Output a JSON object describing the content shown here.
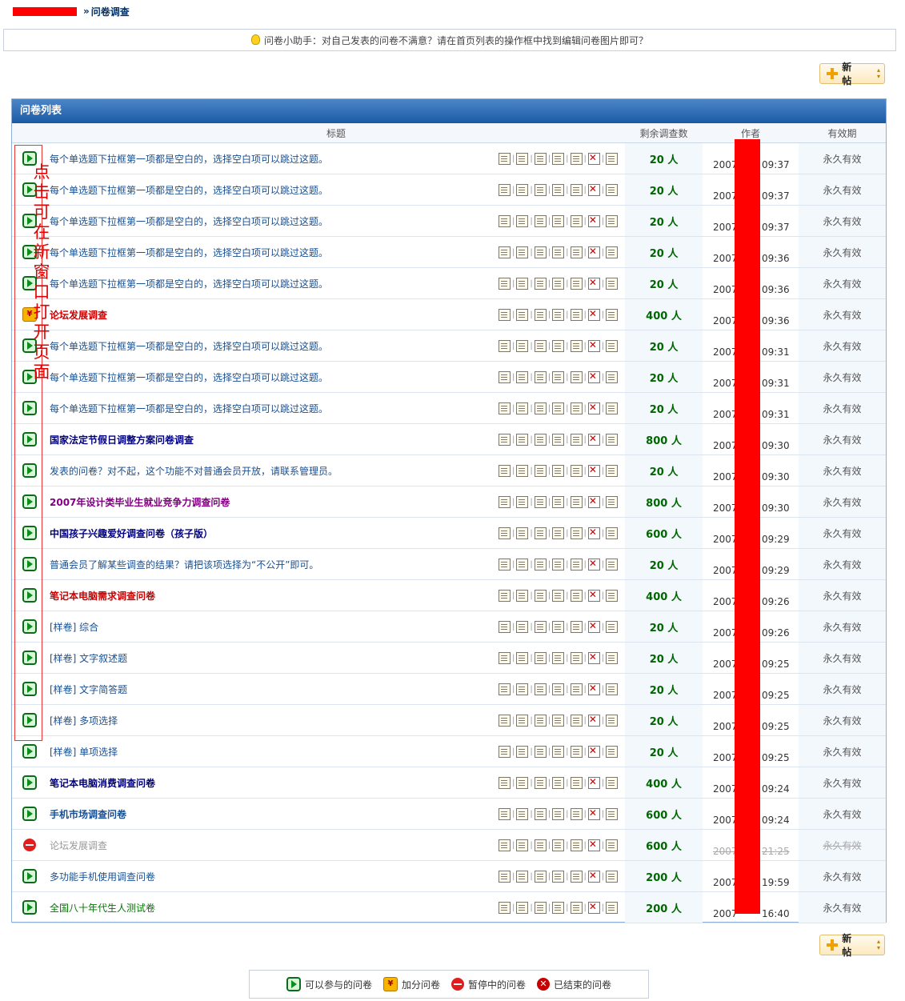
{
  "breadcrumb": {
    "sep": "»",
    "current": "问卷调查"
  },
  "tip": {
    "text": "问卷小助手：对自己发表的问卷不满意？请在首页列表的操作框中找到编辑问卷图片即可？"
  },
  "buttons": {
    "new_post": "新 帖"
  },
  "list": {
    "title": "问卷列表",
    "columns": {
      "title": "标题",
      "remaining": "剩余调查数",
      "author": "作者",
      "validity": "有效期"
    },
    "rows": [
      {
        "status": "play",
        "title": "每个单选题下拉框第一项都是空白的，选择空白项可以跳过这题。",
        "title_color": "#1a4f8f",
        "bold": false,
        "count": "20 人",
        "year": "2007",
        "time": "09:37",
        "validity": "永久有效"
      },
      {
        "status": "play",
        "title": "每个单选题下拉框第一项都是空白的，选择空白项可以跳过这题。",
        "title_color": "#1a4f8f",
        "bold": false,
        "count": "20 人",
        "year": "2007",
        "time": "09:37",
        "validity": "永久有效"
      },
      {
        "status": "play",
        "title": "每个单选题下拉框第一项都是空白的，选择空白项可以跳过这题。",
        "title_color": "#1a4f8f",
        "bold": false,
        "count": "20 人",
        "year": "2007",
        "time": "09:37",
        "validity": "永久有效"
      },
      {
        "status": "play",
        "title": "每个单选题下拉框第一项都是空白的，选择空白项可以跳过这题。",
        "title_color": "#1a4f8f",
        "bold": false,
        "count": "20 人",
        "year": "2007",
        "time": "09:36",
        "validity": "永久有效"
      },
      {
        "status": "play",
        "title": "每个单选题下拉框第一项都是空白的，选择空白项可以跳过这题。",
        "title_color": "#1a4f8f",
        "bold": false,
        "count": "20 人",
        "year": "2007",
        "time": "09:36",
        "validity": "永久有效"
      },
      {
        "status": "bonus",
        "title": "论坛发展调查",
        "title_color": "#cc0000",
        "bold": true,
        "count": "400 人",
        "year": "2007",
        "time": "09:36",
        "validity": "永久有效"
      },
      {
        "status": "play",
        "title": "每个单选题下拉框第一项都是空白的，选择空白项可以跳过这题。",
        "title_color": "#1a4f8f",
        "bold": false,
        "count": "20 人",
        "year": "2007",
        "time": "09:31",
        "validity": "永久有效"
      },
      {
        "status": "play",
        "title": "每个单选题下拉框第一项都是空白的，选择空白项可以跳过这题。",
        "title_color": "#1a4f8f",
        "bold": false,
        "count": "20 人",
        "year": "2007",
        "time": "09:31",
        "validity": "永久有效"
      },
      {
        "status": "play",
        "title": "每个单选题下拉框第一项都是空白的，选择空白项可以跳过这题。",
        "title_color": "#1a4f8f",
        "bold": false,
        "count": "20 人",
        "year": "2007",
        "time": "09:31",
        "validity": "永久有效"
      },
      {
        "status": "play",
        "title": "国家法定节假日调整方案问卷调查",
        "title_color": "#000080",
        "bold": true,
        "count": "800 人",
        "year": "2007",
        "time": "09:30",
        "validity": "永久有效"
      },
      {
        "status": "play",
        "title": "发表的问卷？对不起，这个功能不对普通会员开放，请联系管理员。",
        "title_color": "#1a4f8f",
        "bold": false,
        "count": "20 人",
        "year": "2007",
        "time": "09:30",
        "validity": "永久有效"
      },
      {
        "status": "play",
        "title": "2007年设计类毕业生就业竞争力调查问卷",
        "title_color": "#800080",
        "bold": true,
        "count": "800 人",
        "year": "2007",
        "time": "09:30",
        "validity": "永久有效"
      },
      {
        "status": "play",
        "title": "中国孩子兴趣爱好调查问卷（孩子版）",
        "title_color": "#000080",
        "bold": true,
        "count": "600 人",
        "year": "2007",
        "time": "09:29",
        "validity": "永久有效"
      },
      {
        "status": "play",
        "title": "普通会员了解某些调查的结果？请把该项选择为“不公开”即可。",
        "title_color": "#1a4f8f",
        "bold": false,
        "count": "20 人",
        "year": "2007",
        "time": "09:29",
        "validity": "永久有效"
      },
      {
        "status": "play",
        "title": "笔记本电脑需求调查问卷",
        "title_color": "#cc0000",
        "bold": true,
        "count": "400 人",
        "year": "2007",
        "time": "09:26",
        "validity": "永久有效"
      },
      {
        "status": "play",
        "title": "[样卷] 综合",
        "title_color": "#1a4f8f",
        "bold": false,
        "count": "20 人",
        "year": "2007",
        "time": "09:26",
        "validity": "永久有效"
      },
      {
        "status": "play",
        "title": "[样卷] 文字叙述题",
        "title_color": "#1a4f8f",
        "bold": false,
        "count": "20 人",
        "year": "2007",
        "time": "09:25",
        "validity": "永久有效"
      },
      {
        "status": "play",
        "title": "[样卷] 文字简答题",
        "title_color": "#1a4f8f",
        "bold": false,
        "count": "20 人",
        "year": "2007",
        "time": "09:25",
        "validity": "永久有效"
      },
      {
        "status": "play",
        "title": "[样卷] 多项选择",
        "title_color": "#1a4f8f",
        "bold": false,
        "count": "20 人",
        "year": "2007",
        "time": "09:25",
        "validity": "永久有效"
      },
      {
        "status": "play",
        "title": "[样卷] 单项选择",
        "title_color": "#1a4f8f",
        "bold": false,
        "count": "20 人",
        "year": "2007",
        "time": "09:25",
        "validity": "永久有效"
      },
      {
        "status": "play",
        "title": "笔记本电脑消费调查问卷",
        "title_color": "#000080",
        "bold": true,
        "count": "400 人",
        "year": "2007",
        "time": "09:24",
        "validity": "永久有效"
      },
      {
        "status": "play",
        "title": "手机市场调查问卷",
        "title_color": "#1a4f8f",
        "bold": true,
        "count": "600 人",
        "year": "2007",
        "time": "09:24",
        "validity": "永久有效"
      },
      {
        "status": "pause",
        "title": "论坛发展调查",
        "title_color": "#999999",
        "bold": false,
        "count": "600 人",
        "year": "2007",
        "time": "21:25",
        "validity": "永久有效"
      },
      {
        "status": "play",
        "title": "多功能手机使用调查问卷",
        "title_color": "#1a4f8f",
        "bold": false,
        "count": "200 人",
        "year": "2007",
        "time": "19:59",
        "validity": "永久有效"
      },
      {
        "status": "play",
        "title": "全国八十年代生人测试卷",
        "title_color": "#007700",
        "bold": false,
        "count": "200 人",
        "year": "2007",
        "time": "16:40",
        "validity": "永久有效"
      }
    ]
  },
  "annotation": {
    "text": "点击可在新窗口打开页面"
  },
  "legend": {
    "items": [
      {
        "icon": "play",
        "label": "可以参与的问卷"
      },
      {
        "icon": "bonus",
        "label": "加分问卷"
      },
      {
        "icon": "pause",
        "label": "暂停中的问卷"
      },
      {
        "icon": "ended",
        "label": "已结束的问卷"
      }
    ]
  },
  "colors": {
    "header_blue": "#1a5aa5",
    "count_green": "#006600",
    "redaction_red": "#ff0000"
  }
}
